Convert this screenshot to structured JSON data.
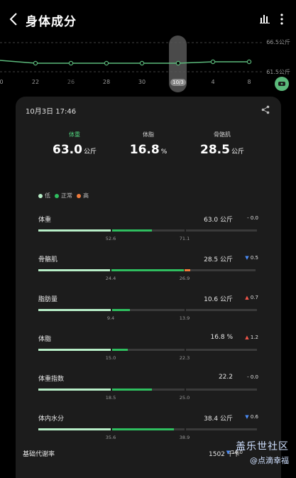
{
  "header": {
    "title": "身体成分"
  },
  "trend": {
    "y_labels": [
      "66.5公斤",
      "61.5公斤"
    ],
    "x_labels": [
      "0",
      "22",
      "26",
      "28",
      "30",
      "10/3",
      "4",
      "8"
    ],
    "selected_label": "10/3",
    "series_color": "#5bb97b"
  },
  "record": {
    "datetime": "10月3日 17:46"
  },
  "summary": [
    {
      "label": "体重",
      "value": "63.0",
      "unit": "公斤"
    },
    {
      "label": "体脂",
      "value": "16.8",
      "unit": "%"
    },
    {
      "label": "骨骼肌",
      "value": "28.5",
      "unit": "公斤"
    }
  ],
  "legend": [
    {
      "label": "低",
      "color": "#b8efc8"
    },
    {
      "label": "正常",
      "color": "#2fbe5f"
    },
    {
      "label": "高",
      "color": "#ef7b3c"
    }
  ],
  "metrics": [
    {
      "name": "体重",
      "value": "63.0 公斤",
      "change_sign": "-",
      "change": "0.0",
      "ticks": [
        "52.6",
        "71.1"
      ],
      "fill_fraction": 0.52
    },
    {
      "name": "骨骼肌",
      "value": "28.5 公斤",
      "change_sign": "▼",
      "change": "0.5",
      "ticks": [
        "24.4",
        "26.9"
      ],
      "fill_fraction": 0.7
    },
    {
      "name": "脂肪量",
      "value": "10.6 公斤",
      "change_sign": "▲",
      "change": "0.7",
      "ticks": [
        "9.4",
        "13.9"
      ],
      "fill_fraction": 0.42
    },
    {
      "name": "体脂",
      "value": "16.8 %",
      "change_sign": "▲",
      "change": "1.2",
      "ticks": [
        "15.0",
        "22.3"
      ],
      "fill_fraction": 0.41
    },
    {
      "name": "体重指数",
      "value": "22.2",
      "change_sign": "-",
      "change": "0.0",
      "ticks": [
        "18.5",
        "25.0"
      ],
      "fill_fraction": 0.52
    },
    {
      "name": "体内水分",
      "value": "38.4 公斤",
      "change_sign": "▼",
      "change": "0.6",
      "ticks": [
        "35.6",
        "38.9"
      ],
      "fill_fraction": 0.62
    }
  ],
  "bmr": {
    "name": "基础代谢率",
    "value": "1502 千卡",
    "change_sign": "▼",
    "change": "16.0"
  },
  "watermark": {
    "line1": "盖乐世社区",
    "line2": "@点滴幸福"
  }
}
